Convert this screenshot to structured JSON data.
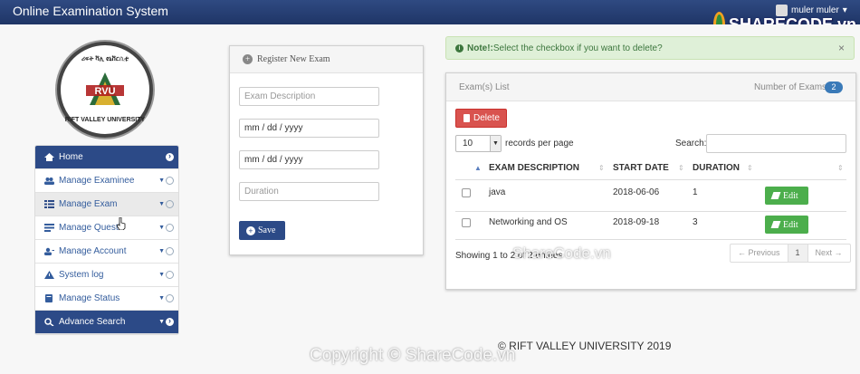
{
  "app": {
    "title": "Online Examination System"
  },
  "user": {
    "name": "muler muler",
    "caret": "▾"
  },
  "brand": {
    "text": "SHARECODE.vn"
  },
  "logo": {
    "top_text": "ሪፍት ቫሊ ዩኒቨርሲቲ",
    "bottom_text": "RIFT VALLEY UNIVERSITY",
    "mark_text": "RVU"
  },
  "sidebar": {
    "items": [
      {
        "label": "Home",
        "icon": "home-icon"
      },
      {
        "label": "Manage Examinee",
        "icon": "users-icon"
      },
      {
        "label": "Manage Exam",
        "icon": "grid-icon"
      },
      {
        "label": "Manage Questi",
        "icon": "list-icon"
      },
      {
        "label": "Manage Account",
        "icon": "user-icon"
      },
      {
        "label": "System log",
        "icon": "warning-icon"
      },
      {
        "label": "Manage Status",
        "icon": "book-icon"
      },
      {
        "label": "Advance Search",
        "icon": "search-icon"
      }
    ]
  },
  "register": {
    "title": "Register New Exam",
    "fields": {
      "description_placeholder": "Exam Description",
      "date1": "mm / dd / yyyy",
      "date2": "mm / dd / yyyy",
      "duration_placeholder": "Duration"
    },
    "save_label": "Save"
  },
  "alert": {
    "prefix": "Note!:",
    "text": " Select the checkbox if you want to delete?",
    "close": "×"
  },
  "list": {
    "title": "Exam(s) List",
    "count_label": "Number of Exams:",
    "count": "2",
    "delete_label": "Delete",
    "page_length": "10",
    "records_label": "records per page",
    "search_label": "Search:",
    "columns": [
      "EXAM DESCRIPTION",
      "START DATE",
      "DURATION"
    ],
    "rows": [
      {
        "description": "java",
        "start_date": "2018-06-06",
        "duration": "1",
        "edit_label": "Edit"
      },
      {
        "description": "Networking and OS",
        "start_date": "2018-09-18",
        "duration": "3",
        "edit_label": "Edit"
      }
    ],
    "showing": "Showing 1 to 2 of 2 entries",
    "pager": {
      "previous": "← Previous",
      "current": "1",
      "next": "Next →"
    }
  },
  "footer": {
    "text": "© RIFT VALLEY UNIVERSITY 2019"
  },
  "watermarks": {
    "center": "ShareCode.vn",
    "bottom": "Copyright © ShareCode.vn"
  },
  "colors": {
    "navy": "#2c4a87",
    "danger": "#d9534f",
    "success": "#4cae4c",
    "alert_bg": "#dff0d8"
  }
}
